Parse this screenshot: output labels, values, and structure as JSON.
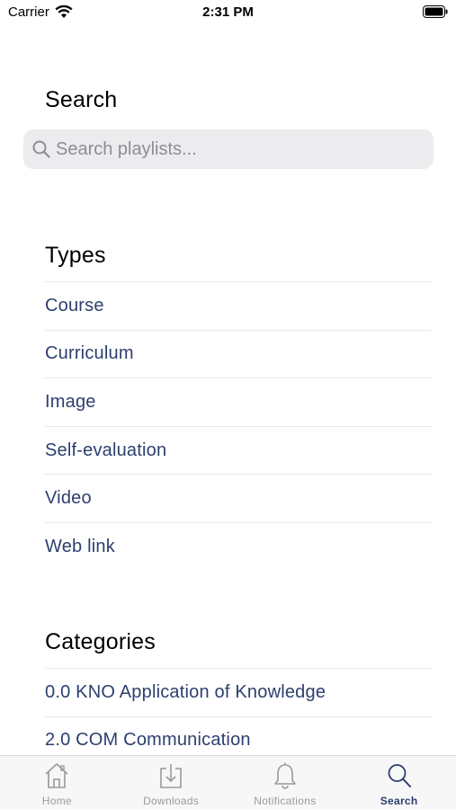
{
  "status_bar": {
    "carrier": "Carrier",
    "time": "2:31 PM"
  },
  "search": {
    "title": "Search",
    "placeholder": "Search playlists..."
  },
  "types": {
    "title": "Types",
    "items": [
      "Course",
      "Curriculum",
      "Image",
      "Self-evaluation",
      "Video",
      "Web link"
    ]
  },
  "categories": {
    "title": "Categories",
    "items": [
      "0.0 KNO Application of Knowledge",
      "2.0 COM Communication"
    ]
  },
  "tab_bar": {
    "tabs": [
      {
        "label": "Home",
        "icon": "home-icon"
      },
      {
        "label": "Downloads",
        "icon": "download-icon"
      },
      {
        "label": "Notifications",
        "icon": "bell-icon"
      },
      {
        "label": "Search",
        "icon": "search-icon"
      }
    ],
    "active_tab": "Search"
  },
  "colors": {
    "accent": "#2c3f6e",
    "inactive": "#9a9a9a",
    "search_bg": "#ececee"
  }
}
